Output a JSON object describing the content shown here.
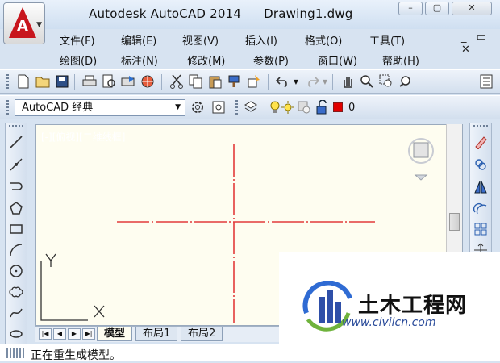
{
  "window": {
    "title": "Autodesk AutoCAD 2014",
    "document": "Drawing1.dwg",
    "minimize_label": "–",
    "maximize_label": "▢",
    "close_label": "✕",
    "mdi_controls": "_ ▭ ✕"
  },
  "menus": {
    "row1": [
      "文件(F)",
      "编辑(E)",
      "视图(V)",
      "插入(I)",
      "格式(O)",
      "工具(T)"
    ],
    "row2": [
      "绘图(D)",
      "标注(N)",
      "修改(M)",
      "参数(P)",
      "窗口(W)",
      "帮助(H)"
    ]
  },
  "workspace": {
    "current": "AutoCAD 经典"
  },
  "layer": {
    "current": "0",
    "color": "#e00000"
  },
  "viewport": {
    "label": "[-][俯视][二维线框]"
  },
  "tabs": [
    "模型",
    "布局1",
    "布局2"
  ],
  "command": {
    "status": "正在重生成模型。"
  },
  "watermark": {
    "text": "土木工程网",
    "url": "www.civilcn.com"
  },
  "colors": {
    "crosshair": "#e23b3b",
    "canvas": "#fefdf0",
    "accent": "#c8161d"
  }
}
